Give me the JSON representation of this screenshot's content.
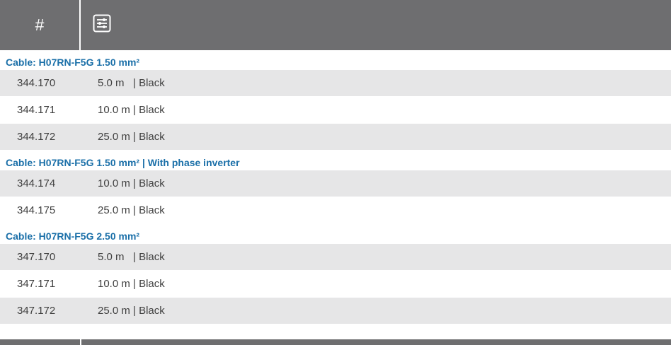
{
  "header": {
    "number_label": "#",
    "filter_icon": "sliders-icon"
  },
  "groups": [
    {
      "title": "Cable: H07RN-F5G 1.50 mm²",
      "rows": [
        {
          "code": "344.170",
          "desc": "5.0 m   | Black"
        },
        {
          "code": "344.171",
          "desc": "10.0 m | Black"
        },
        {
          "code": "344.172",
          "desc": "25.0 m | Black"
        }
      ]
    },
    {
      "title": "Cable: H07RN-F5G 1.50 mm² | With phase inverter",
      "rows": [
        {
          "code": "344.174",
          "desc": "10.0 m | Black"
        },
        {
          "code": "344.175",
          "desc": "25.0 m | Black"
        }
      ]
    },
    {
      "title": "Cable: H07RN-F5G 2.50 mm²",
      "rows": [
        {
          "code": "347.170",
          "desc": "5.0 m   | Black"
        },
        {
          "code": "347.171",
          "desc": "10.0 m | Black"
        },
        {
          "code": "347.172",
          "desc": "25.0 m | Black"
        }
      ]
    }
  ],
  "colors": {
    "header_bg": "#6e6e70",
    "group_title": "#1a6fa8",
    "row_alt": "#e6e6e7"
  }
}
